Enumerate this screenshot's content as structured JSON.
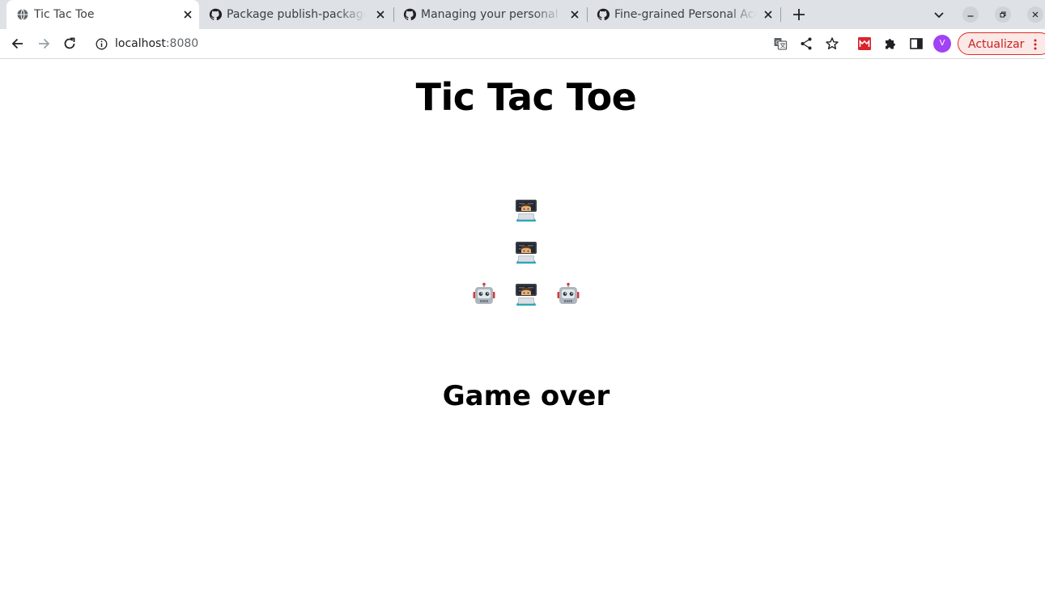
{
  "browser": {
    "tabs": [
      {
        "title": "Tic Tac Toe",
        "favicon": "globe-icon",
        "active": true
      },
      {
        "title": "Package publish-packages",
        "favicon": "github-icon",
        "active": false
      },
      {
        "title": "Managing your personal acc",
        "favicon": "github-icon",
        "active": false
      },
      {
        "title": "Fine-grained Personal Acce",
        "favicon": "github-icon",
        "active": false
      }
    ],
    "address": {
      "host": "localhost",
      "port": ":8080"
    },
    "profile_initial": "V",
    "update_label": "Actualizar",
    "colors": {
      "tabstrip": "#dee1e6",
      "update_border": "#d93025",
      "update_text": "#c5221f",
      "avatar": "#a142f4"
    }
  },
  "page": {
    "title": "Tic Tac Toe",
    "status": "Game over",
    "board": [
      [
        "",
        "human",
        ""
      ],
      [
        "",
        "human",
        ""
      ],
      [
        "robot",
        "human",
        "robot"
      ]
    ],
    "pieces": {
      "human": "technologist-emoji",
      "robot": "robot-emoji"
    }
  }
}
